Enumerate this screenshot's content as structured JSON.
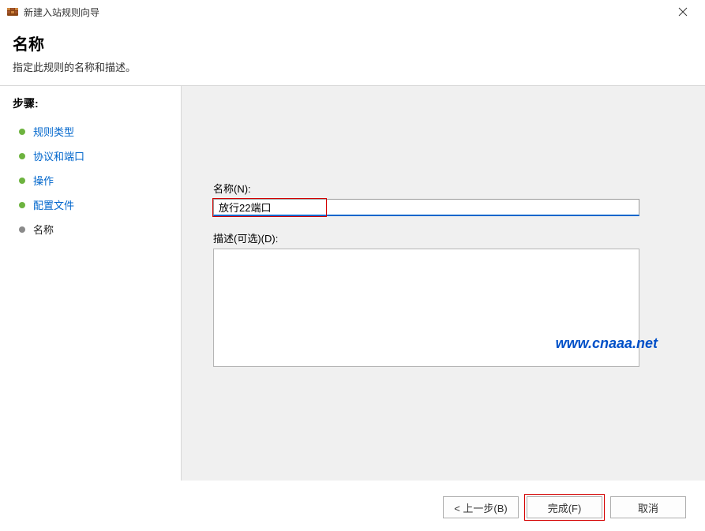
{
  "titlebar": {
    "title": "新建入站规则向导"
  },
  "header": {
    "title": "名称",
    "subtitle": "指定此规则的名称和描述。"
  },
  "sidebar": {
    "stepsLabel": "步骤:",
    "items": [
      {
        "label": "规则类型",
        "current": false
      },
      {
        "label": "协议和端口",
        "current": false
      },
      {
        "label": "操作",
        "current": false
      },
      {
        "label": "配置文件",
        "current": false
      },
      {
        "label": "名称",
        "current": true
      }
    ]
  },
  "main": {
    "nameLabel": "名称(N):",
    "nameValue": "放行22端口",
    "descLabel": "描述(可选)(D):",
    "descValue": ""
  },
  "watermark": "www.cnaaa.net",
  "footer": {
    "back": "< 上一步(B)",
    "finish": "完成(F)",
    "cancel": "取消"
  }
}
